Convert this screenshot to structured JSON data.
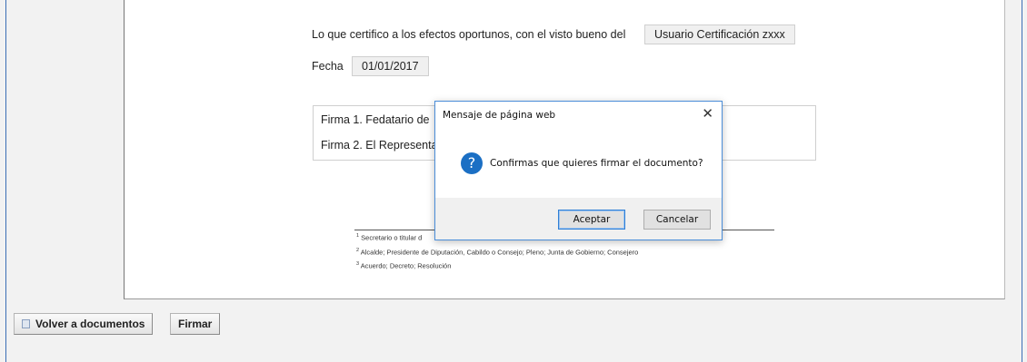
{
  "document": {
    "certify_text": "Lo que certifico a los efectos oportunos, con el visto bueno del",
    "approver_value": "Usuario Certificación zxxx",
    "date_label": "Fecha",
    "date_value": "01/01/2017",
    "signatures": [
      "Firma 1. Fedatario de",
      "Firma 2. El Representa"
    ],
    "footnotes": [
      {
        "num": "1",
        "text": "Secretario o titular d"
      },
      {
        "num": "2",
        "text": "Alcalde; Presidente de Diputación, Cabildo o Consejo; Pleno; Junta de Gobierno; Consejero"
      },
      {
        "num": "3",
        "text": "Acuerdo; Decreto; Resolución"
      }
    ]
  },
  "actions": {
    "back_label": "Volver a documentos",
    "sign_label": "Firmar"
  },
  "dialog": {
    "title": "Mensaje de página web",
    "close_glyph": "✕",
    "icon_glyph": "?",
    "message": "Confirmas que quieres firmar el documento?",
    "ok_label": "Aceptar",
    "cancel_label": "Cancelar"
  },
  "colors": {
    "frame_blue": "#3b6fb5",
    "question_icon": "#1b6fc4"
  }
}
